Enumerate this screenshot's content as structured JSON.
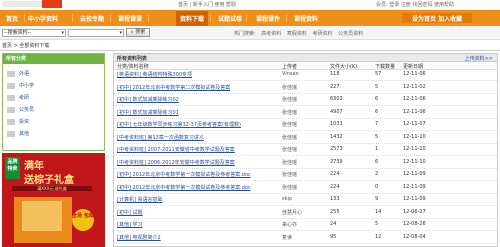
{
  "topbar": {
    "links_left": "首页 | 新手入门 使用 帮助",
    "links_right": "会员: 登录 注册 找回密码 使用帮助"
  },
  "nav": {
    "items": [
      "首页",
      "中小学资料",
      "云校专题",
      "课程课课",
      "资料下载",
      "试题试卷",
      "课程课件",
      "课程资料"
    ],
    "active_index": 4,
    "right_label": "设为首页  加入收藏"
  },
  "search": {
    "select_value": "--搜索资料--",
    "input_value": "",
    "button_label": "搜索",
    "hot_label": "热门搜索:",
    "hot_items": [
      "高考资料",
      "寒假资料",
      "考研资料",
      "公务员资料"
    ]
  },
  "breadcrumb": "首页 > 全部资料下载",
  "sidebar": {
    "title": "所有分类",
    "items": [
      "外语",
      "中小学",
      "考研",
      "公务员",
      "投资",
      "其他"
    ]
  },
  "ad": {
    "tag": "品牌 特卖",
    "line1": "满年",
    "line2": "送棕子礼盒",
    "line3": "满XXX元 送礼盒",
    "badge": "全场 包邮"
  },
  "list": {
    "title": "所有资料列表",
    "upload_label": "上传资料>>",
    "columns": [
      "分类/资料名称",
      "上传者",
      "文件大小(K)",
      "下载数量",
      "更新日期"
    ],
    "rows": [
      [
        "[英语资料] 英语结构特殊300专项",
        "Vinsan",
        "118",
        "57",
        "12-11-06"
      ],
      [
        "[初中] 2012年北京中考数学第二次模拟试卷及答案",
        "张佳瑶",
        "227",
        "5",
        "12-11-02"
      ],
      [
        "[初中] 数式加减乘除练习02",
        "张佳瑶",
        "6303",
        "6",
        "12-11-06"
      ],
      [
        "[初中] 数式加减乘除练习01",
        "张佳瑶",
        "4907",
        "6",
        "12-11-06"
      ],
      [
        "[初中] 七年级数学同步练习第32-37页参考答案(有理数)",
        "张佳瑶",
        "1031",
        "7",
        "12-11-07"
      ],
      [
        "[中考资料班] 第13章一次函数复习讲义",
        "张佳瑶",
        "1432",
        "5",
        "12-11-10"
      ],
      [
        "[中考资料班] 2007-2011安徽省中考数学试题及答案",
        "张佳瑶",
        "2573",
        "1",
        "12-11-10"
      ],
      [
        "[中考资料班] 2006-2012年安徽中考数学试题及答案",
        "张佳瑶",
        "2739",
        "6",
        "12-11-10"
      ],
      [
        "[初中] 2012年北京中考数学第一次模拟试卷及参考答案.doc",
        "张佳瑶",
        "224",
        "2",
        "12-11-09"
      ],
      [
        "[初中] 2012年北京中考数学第一次模拟试卷及参考答案.doc",
        "张佳瑶",
        "224",
        "0",
        "12-11-09"
      ],
      [
        "[计算机] 易语言基础",
        "skip",
        "133",
        "9",
        "12-11-09"
      ],
      [
        "[初中] 试题",
        "佳慧月心",
        "255",
        "14",
        "12-06-27"
      ],
      [
        "[其他] 学习",
        "来心亦",
        "24",
        "5",
        "12-08-26"
      ],
      [
        "[其他] 电视剧简介2",
        "复读",
        "95",
        "12",
        "12-08-04"
      ]
    ]
  },
  "colors": {
    "nav": "#f08e1a",
    "nav_active": "#d26300",
    "sidebar_green": "#6db33f",
    "ad_red": "#c0161a",
    "link": "#2a4f9a"
  }
}
